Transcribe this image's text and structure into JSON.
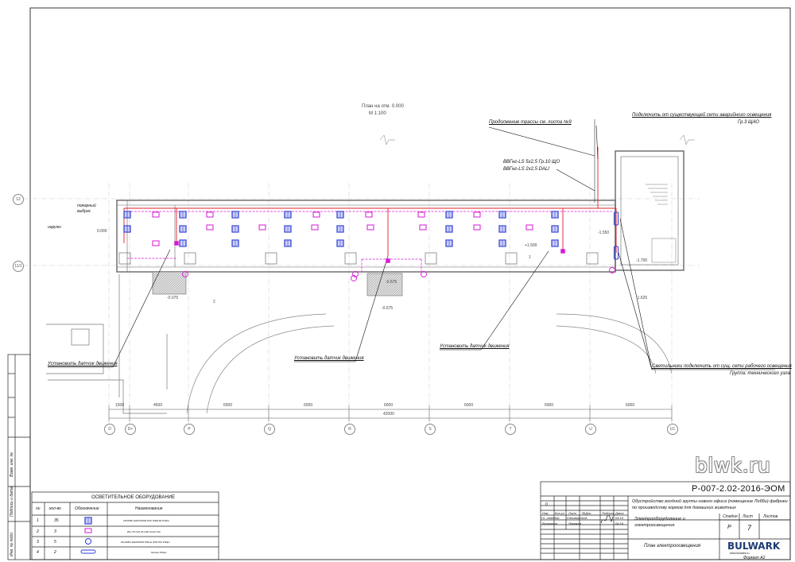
{
  "plan": {
    "title": "План на отм. 0.000",
    "scale": "М 1:100",
    "axes_horizontal": [
      "D",
      "D+",
      "P",
      "Q",
      "R",
      "S",
      "T",
      "U",
      "U1"
    ],
    "axes_vertical": [
      "12",
      "11/1"
    ],
    "dimensions": [
      "1500",
      "4500",
      "6000",
      "6000",
      "6000",
      "6000",
      "6000",
      "6000"
    ],
    "total_dimension": "42000",
    "levels": [
      "0.000",
      "-0.075",
      "-0.675",
      "-0.675",
      "+1.500",
      "-1.550",
      "-1.700",
      "-1.625"
    ],
    "room_number": "1",
    "room_number_2": "2"
  },
  "annotations": {
    "continuation": "Продолжение трассы см. листа №9",
    "connect_emergency": "Подключить от существующей сети аварийного освещения",
    "connect_emergency_group": "Гр.3 ЩАО",
    "cable1": "ВВГнг-LS 5х2,5 Гр.10 ЩО",
    "cable2": "ВВГнг-LS 2х2,5 DALI",
    "sensor1": "Установить датчик движения",
    "sensor2": "Установить датчик движения",
    "sensor3": "Установить датчик движения",
    "connect_work": "Светильники подключить от сущ. сети рабочего освещения",
    "connect_work_group": "Группа: технического узла",
    "passage": "пожарный выброс",
    "outside": "наружн"
  },
  "legend": {
    "title": "ОСВЕТИТЕЛЬНОЕ ОБОРУДОВАНИЕ",
    "headers": [
      "№",
      "кол-во",
      "Обозначение",
      "Наименование"
    ],
    "rows": [
      {
        "n": "1",
        "qty": "35",
        "name": "CR250B LED37S/840 PSU W60L60 Philips",
        "symbol": "blue-square"
      },
      {
        "n": "2",
        "qty": "3",
        "name": "RS-170-4x8,25-LED Gravit Olsr",
        "symbol": "magenta-rect"
      },
      {
        "n": "3",
        "qty": "5",
        "name": "DN130B LED20S/840 PSD-E IP44 WH Philips",
        "symbol": "circle"
      },
      {
        "n": "4",
        "qty": "2",
        "name": "Module Philips",
        "symbol": "rounded-rect"
      }
    ]
  },
  "side_stamp": [
    "Взам. инв. №",
    "Подпись и дата",
    "Инв. № подл."
  ],
  "titleblock": {
    "code": "Р-007-2.02-2016-ЭОМ",
    "project": "Обустройство входной группы нового офиса (помещение Лобби) фабрики по производству кормов для домашних животных",
    "section": "Электрооборудование и электроосвещение",
    "sheet_title": "План электроосвещения",
    "stage_label": "Стадия",
    "sheet_label": "Лист",
    "sheets_label": "Листов",
    "stage": "Р",
    "sheet": "7",
    "sheets": "",
    "header_cols": [
      "Изм.",
      "Кол.уч",
      "Лист",
      "№Док.",
      "Подпись",
      "Дата"
    ],
    "rev": "0",
    "row1_role": "Гл. инженер",
    "row1_name": "Селиверстов",
    "row1_date": "04.16",
    "row2_role": "Выполнил",
    "row2_name": "Ломакин",
    "row2_date": "04.16",
    "format": "Формат А2",
    "brand": "BULWARK",
    "brand_sub": "www.bulwark.ru"
  },
  "watermark": "blwk.ru",
  "colors": {
    "lamp": "#2b3bd6",
    "power": "#e0202a",
    "dali": "#d61ad6",
    "wall": "#777777"
  }
}
